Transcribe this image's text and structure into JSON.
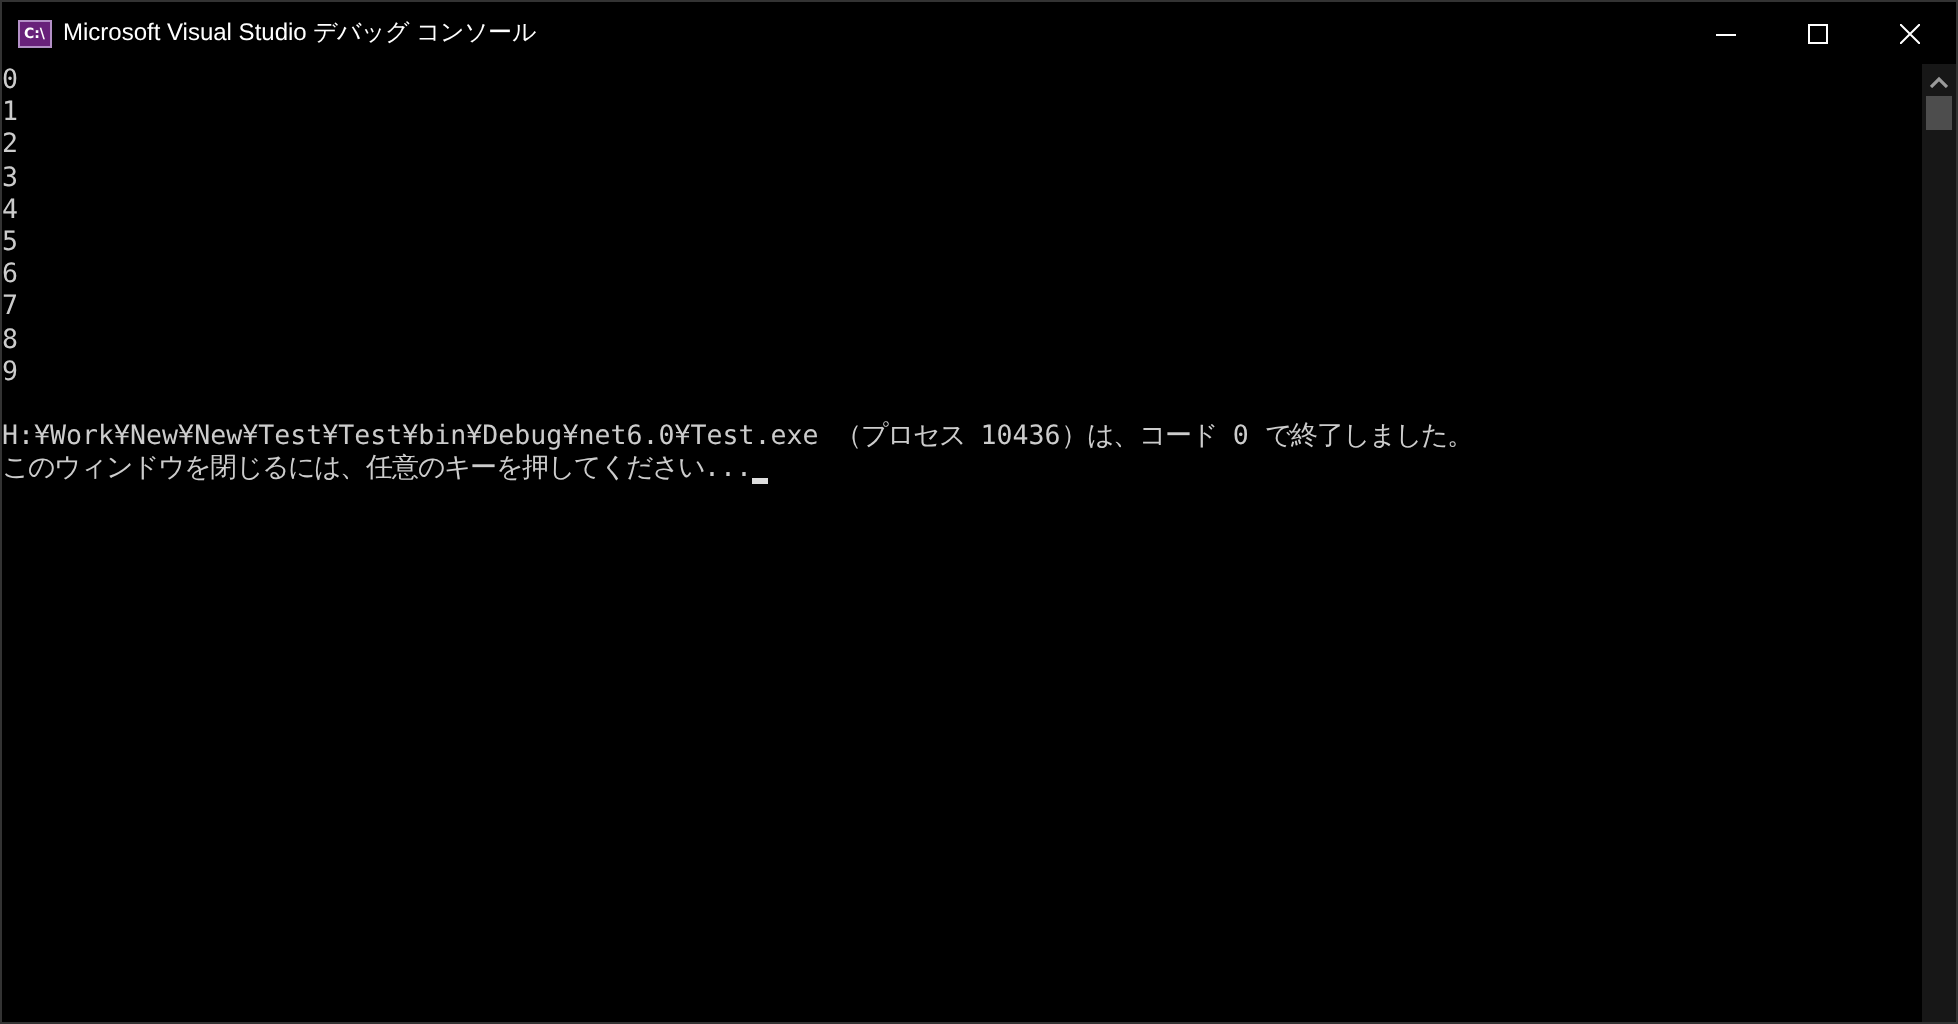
{
  "window": {
    "title": "Microsoft Visual Studio デバッグ コンソール",
    "app_icon": "C:\\"
  },
  "console": {
    "output_lines": [
      "0",
      "1",
      "2",
      "3",
      "4",
      "5",
      "6",
      "7",
      "8",
      "9"
    ],
    "exit_lines": [
      "H:¥Work¥New¥New¥Test¥Test¥bin¥Debug¥net6.0¥Test.exe （プロセス 10436）は、コード 0 で終了しました。",
      "このウィンドウを閉じるには、任意のキーを押してください..."
    ]
  }
}
